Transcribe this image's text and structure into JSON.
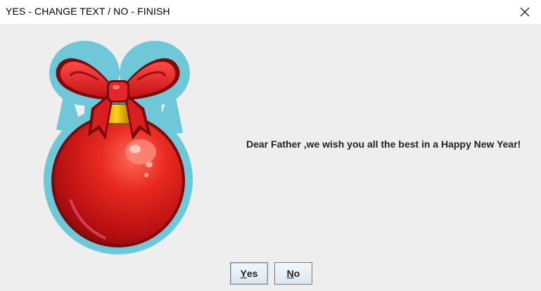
{
  "window": {
    "title": "YES - CHANGE TEXT / NO - FINISH"
  },
  "message": {
    "text": "Dear Father ,we wish you all the best in a Happy New Year!"
  },
  "buttons": {
    "yes": {
      "mnemonic": "Y",
      "rest": "es",
      "focused": true
    },
    "no": {
      "mnemonic": "N",
      "rest": "o"
    }
  },
  "image": {
    "depicts": "red-christmas-ornament-with-bow",
    "colors": {
      "ornament": "#d81e1e",
      "bow": "#e8262a",
      "outline": "#6fc8d8",
      "cap": "#e8b800"
    }
  }
}
